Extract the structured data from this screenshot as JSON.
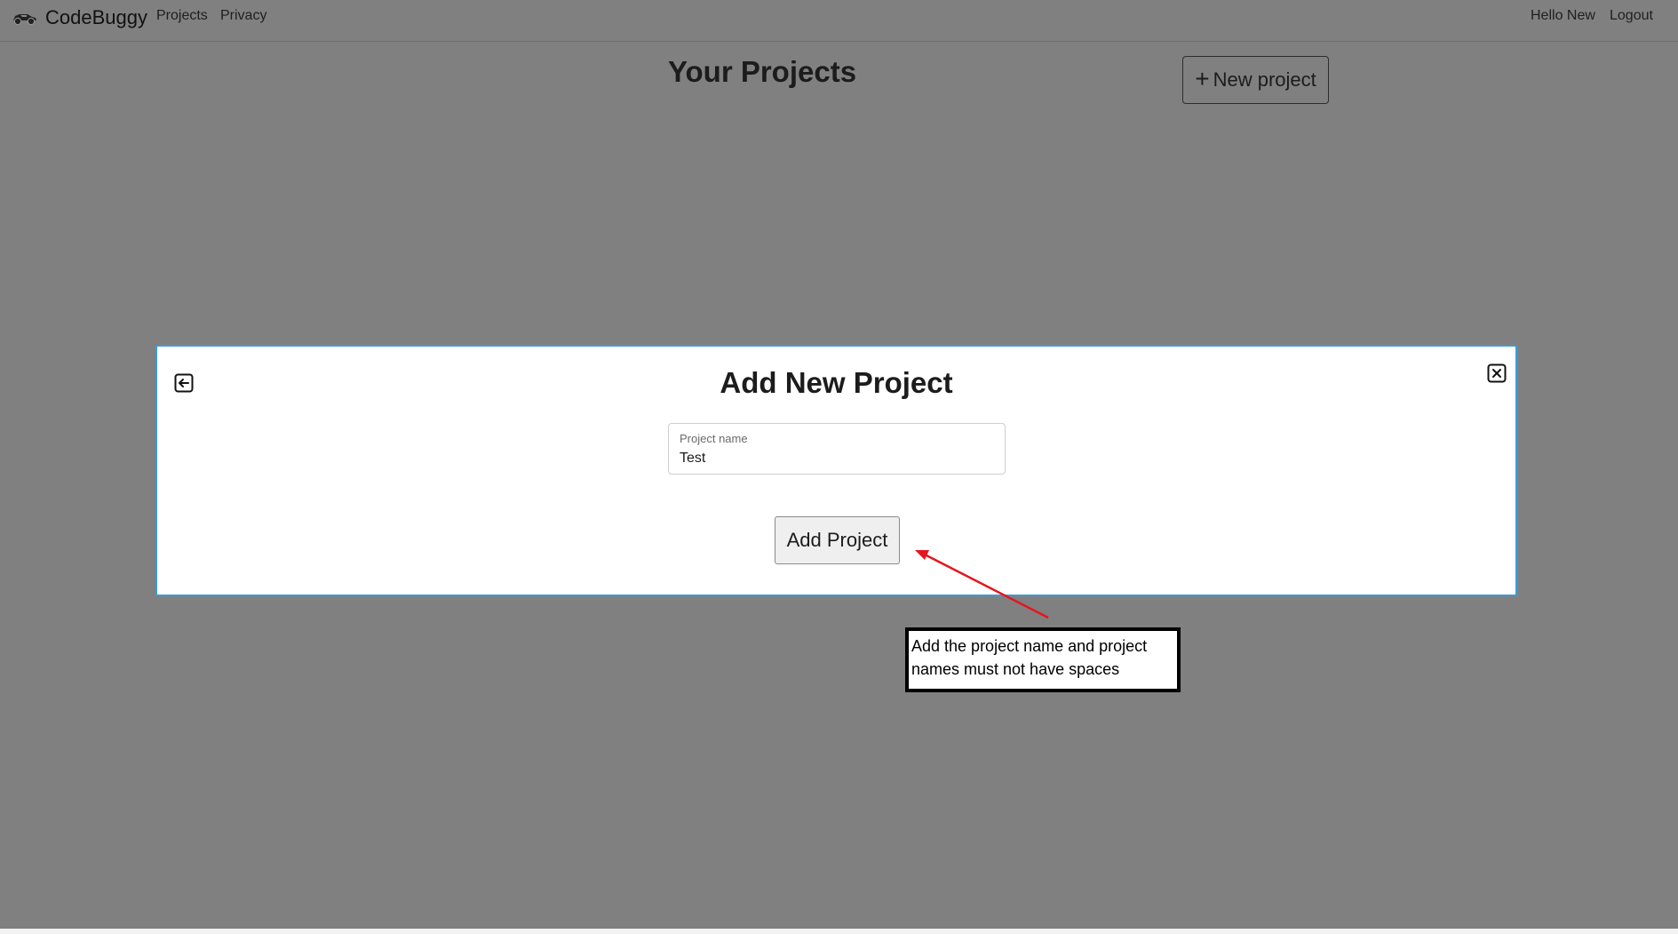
{
  "navbar": {
    "brand": "CodeBuggy",
    "links": [
      "Projects",
      "Privacy"
    ],
    "greeting": "Hello New",
    "logout": "Logout"
  },
  "page": {
    "title": "Your Projects",
    "new_project_plus": "+",
    "new_project_label": "New project"
  },
  "modal": {
    "title": "Add New Project",
    "field_label": "Project name",
    "field_value": "Test",
    "submit_label": "Add Project"
  },
  "annotation": {
    "text": "Add the project name and project names must not have spaces",
    "arrow_color": "#e5151d"
  },
  "colors": {
    "backdrop": "#808080",
    "modal_border": "#3d9bd8"
  }
}
